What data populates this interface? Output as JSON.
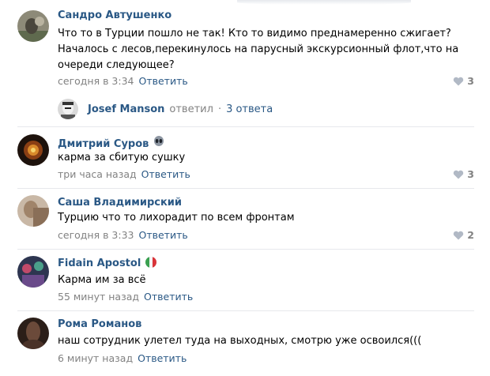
{
  "comments": [
    {
      "author": "Сандро Автушенко",
      "lines": [
        "Что то в Турции пошло не так! Кто то видимо преднамеренно сжигает?",
        "Началось с лесов,перекинулось на парусный экскурсионный флот,что на",
        "очереди следующее?"
      ],
      "time": "сегодня в 3:34",
      "reply_label": "Ответить",
      "likes": "3"
    },
    {
      "author": "Дмитрий Суров",
      "lines": [
        "карма за сбитую сушку"
      ],
      "time": "три часа назад",
      "reply_label": "Ответить",
      "likes": "3"
    },
    {
      "author": "Саша Владимирский",
      "lines": [
        "Турцию что то лихорадит по всем фронтам"
      ],
      "time": "сегодня в 3:33",
      "reply_label": "Ответить",
      "likes": "2"
    },
    {
      "author": "Fidain Apostol",
      "lines": [
        "Карма им за всё"
      ],
      "time": "55 минут назад",
      "reply_label": "Ответить"
    },
    {
      "author": "Рома Романов",
      "lines": [
        "наш сотрудник улетел туда на выходных, смотрю уже освоился((("
      ],
      "time": "6 минут назад",
      "reply_label": "Ответить"
    }
  ],
  "replies_preview": {
    "name": "Josef Manson",
    "verb": "ответил",
    "separator": "·",
    "count": "3 ответа"
  },
  "icons": {
    "like": "heart-icon",
    "alien": "alien-emoji-icon",
    "flag": "italy-flag-icon"
  },
  "colors": {
    "link": "#2a5885",
    "meta": "#828282",
    "divider": "#e7e8ec"
  }
}
